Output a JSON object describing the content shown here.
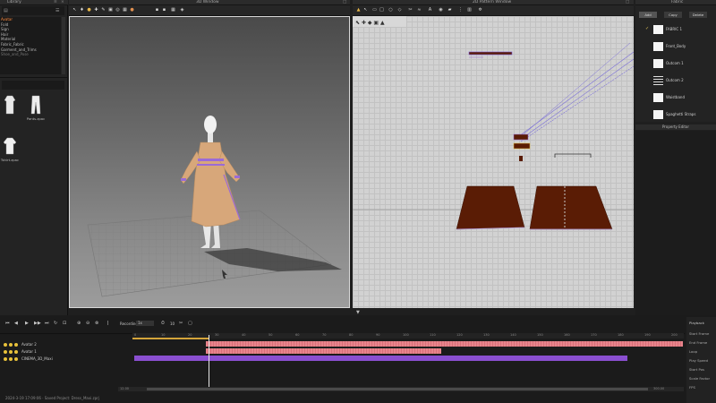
{
  "titles": {
    "library": "Library",
    "window3d": "3D Window",
    "window2d": "2D Pattern Window",
    "fabric": "Fabric",
    "property": "Property Editor"
  },
  "library": {
    "tree_items": [
      "Avatar",
      "Fold",
      "Sign",
      "Hair",
      "Material",
      "Fabric_Fabric",
      "Garment_and_Trims",
      "Shoe_and_Pose"
    ],
    "thumbnails": [
      {
        "label": "",
        "icon": "shirt-icon"
      },
      {
        "label": "Pants.zpac",
        "icon": "pants-icon"
      },
      {
        "label": "Tshirt.zpac",
        "icon": "tshirt-icon"
      }
    ]
  },
  "fabric": {
    "tabs": [
      "Add",
      "Copy",
      "Delete"
    ],
    "items": [
      {
        "name": "FABRIC 1",
        "checked": true,
        "swatch": "#ffffff"
      },
      {
        "name": "Front_Body",
        "checked": false,
        "swatch": "#ffffff"
      },
      {
        "name": "Outcom 1",
        "checked": false,
        "swatch": "#ffffff"
      },
      {
        "name": "Outcom 2",
        "checked": false,
        "swatch": "lines"
      },
      {
        "name": "Waistband",
        "checked": false,
        "swatch": "#ffffff"
      },
      {
        "name": "Spaghetti Straps",
        "checked": false,
        "swatch": "#ffffff"
      }
    ]
  },
  "animation": {
    "mode_label": "Recording Mode",
    "zoom_label": "1x",
    "frame_value": "10",
    "tracks": [
      {
        "name": "Avatar 2",
        "dots": 3
      },
      {
        "name": "Avatar 1",
        "dots": 3
      },
      {
        "name": "CINEMA_3D_Maxi",
        "dots": 3
      }
    ],
    "ruler_ticks": [
      "0",
      "10",
      "20",
      "30",
      "40",
      "50",
      "60",
      "70",
      "80",
      "90",
      "100",
      "110",
      "120",
      "130",
      "140",
      "150",
      "160",
      "170",
      "180",
      "190",
      "200"
    ],
    "start_time": "12.00",
    "end_time": "300.00",
    "right_panel": [
      "Playback",
      "Start Frame",
      "End Frame",
      "Loop",
      "Play Speed",
      "Start Pos",
      "Scale Factor",
      "FPS"
    ]
  },
  "status": "2024-3-19 17:09:06 · Saved Project: Dress_Maxi.zprj",
  "colors": {
    "garment_beige": "#d7a77a",
    "pattern_brown": "#5a1c05",
    "track_pink": "#e8848c",
    "track_purple": "#8a4fd0",
    "accent_orange": "#ff8a3d"
  }
}
